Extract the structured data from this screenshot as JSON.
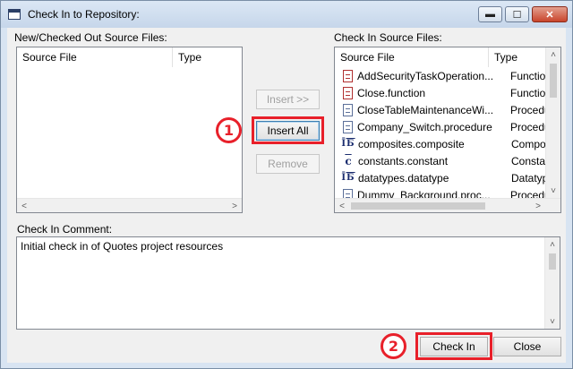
{
  "window": {
    "title": "Check In to Repository:",
    "minimize_glyph": "▬",
    "maximize_glyph": "☐",
    "close_glyph": "✕"
  },
  "left_panel": {
    "label": "New/Checked Out Source Files:",
    "columns": [
      "Source File",
      "Type"
    ]
  },
  "right_panel": {
    "label": "Check In Source Files:",
    "columns": [
      "Source File",
      "Type"
    ],
    "rows": [
      {
        "icon": "function-doc-icon",
        "file": "AddSecurityTaskOperation...",
        "type": "Function"
      },
      {
        "icon": "function-doc-icon",
        "file": "Close.function",
        "type": "Function"
      },
      {
        "icon": "procedure-doc-icon",
        "file": "CloseTableMaintenanceWi...",
        "type": "Procedure"
      },
      {
        "icon": "procedure-doc-icon",
        "file": "Company_Switch.procedure",
        "type": "Procedure"
      },
      {
        "icon": "composite-icon",
        "file": "composites.composite",
        "type": "Composite"
      },
      {
        "icon": "constant-icon",
        "file": "constants.constant",
        "type": "Constant"
      },
      {
        "icon": "datatype-icon",
        "file": "datatypes.datatype",
        "type": "Datatype"
      },
      {
        "icon": "procedure-doc-icon",
        "file": "Dummy_Background.proc...",
        "type": "Procedure"
      }
    ]
  },
  "buttons": {
    "insert": "Insert >>",
    "insert_all": "Insert All",
    "remove": "Remove",
    "check_in": "Check In",
    "close": "Close"
  },
  "comment": {
    "label": "Check In Comment:",
    "value": "Initial check in of Quotes project resources"
  },
  "callouts": {
    "step1": "1",
    "step2": "2"
  },
  "scroll_glyphs": {
    "left": "<",
    "right": ">",
    "up": "˄",
    "down": "˅"
  },
  "colors": {
    "highlight": "#e8202a",
    "titlebar": "#c6d6ea"
  }
}
